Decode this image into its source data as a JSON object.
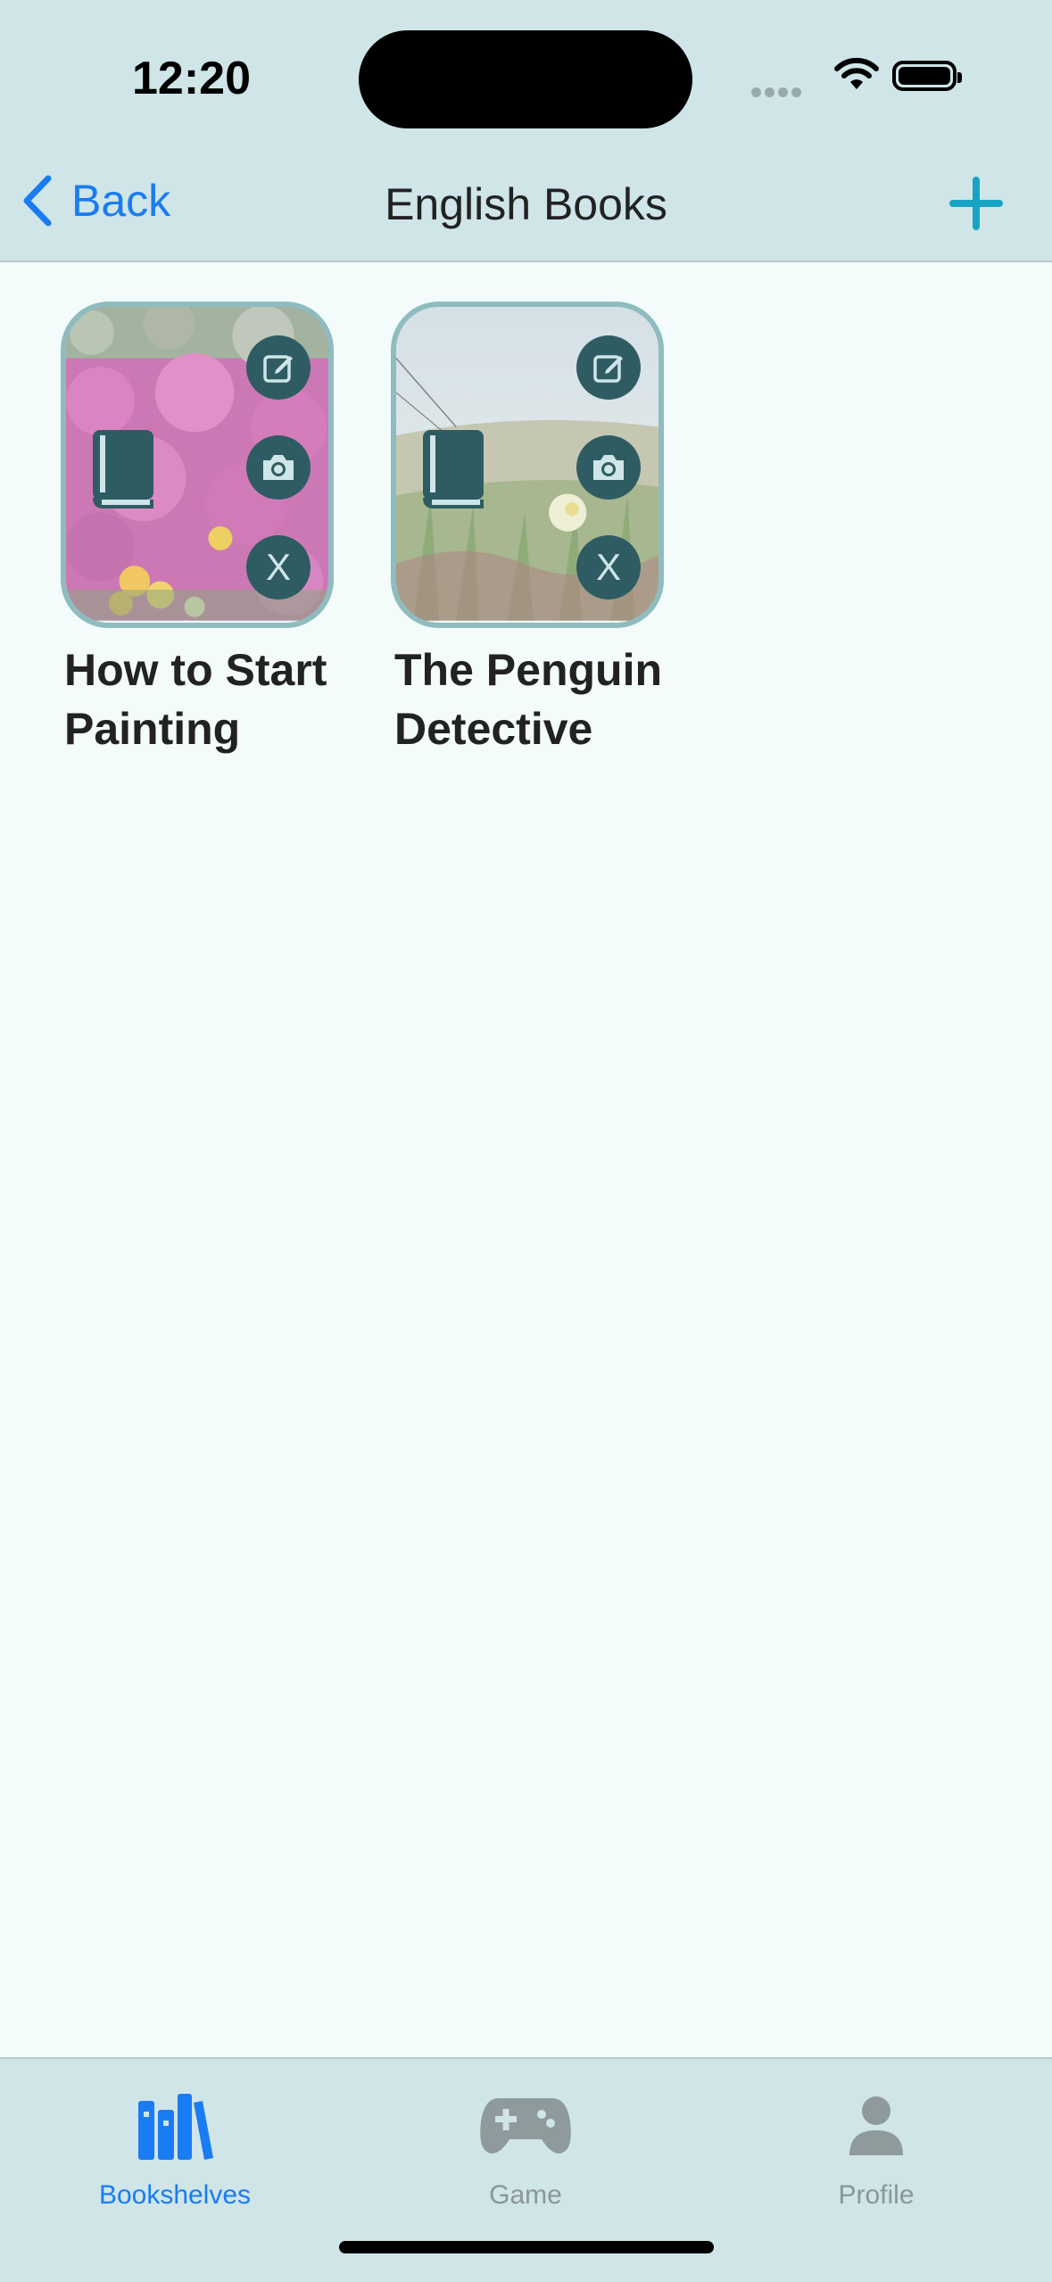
{
  "status_bar": {
    "time": "12:20"
  },
  "nav": {
    "back_label": "Back",
    "title": "English Books",
    "add_icon": "plus-icon"
  },
  "books": [
    {
      "title": "How to Start Painting",
      "cover": "pink-flowers-photo",
      "actions": [
        "edit-icon",
        "camera-icon",
        "close-icon"
      ]
    },
    {
      "title": "The Penguin Detective",
      "cover": "beach-grass-photo",
      "actions": [
        "edit-icon",
        "camera-icon",
        "close-icon"
      ]
    }
  ],
  "delete_glyph": "X",
  "tabs": [
    {
      "label": "Bookshelves",
      "icon": "bookshelves-icon",
      "active": true
    },
    {
      "label": "Game",
      "icon": "gamepad-icon",
      "active": false
    },
    {
      "label": "Profile",
      "icon": "person-icon",
      "active": false
    }
  ],
  "colors": {
    "accent": "#1a7cf2",
    "header_bg": "#cfe5e8",
    "content_bg": "#f3fbfb",
    "button_dark": "#2e5c62"
  }
}
